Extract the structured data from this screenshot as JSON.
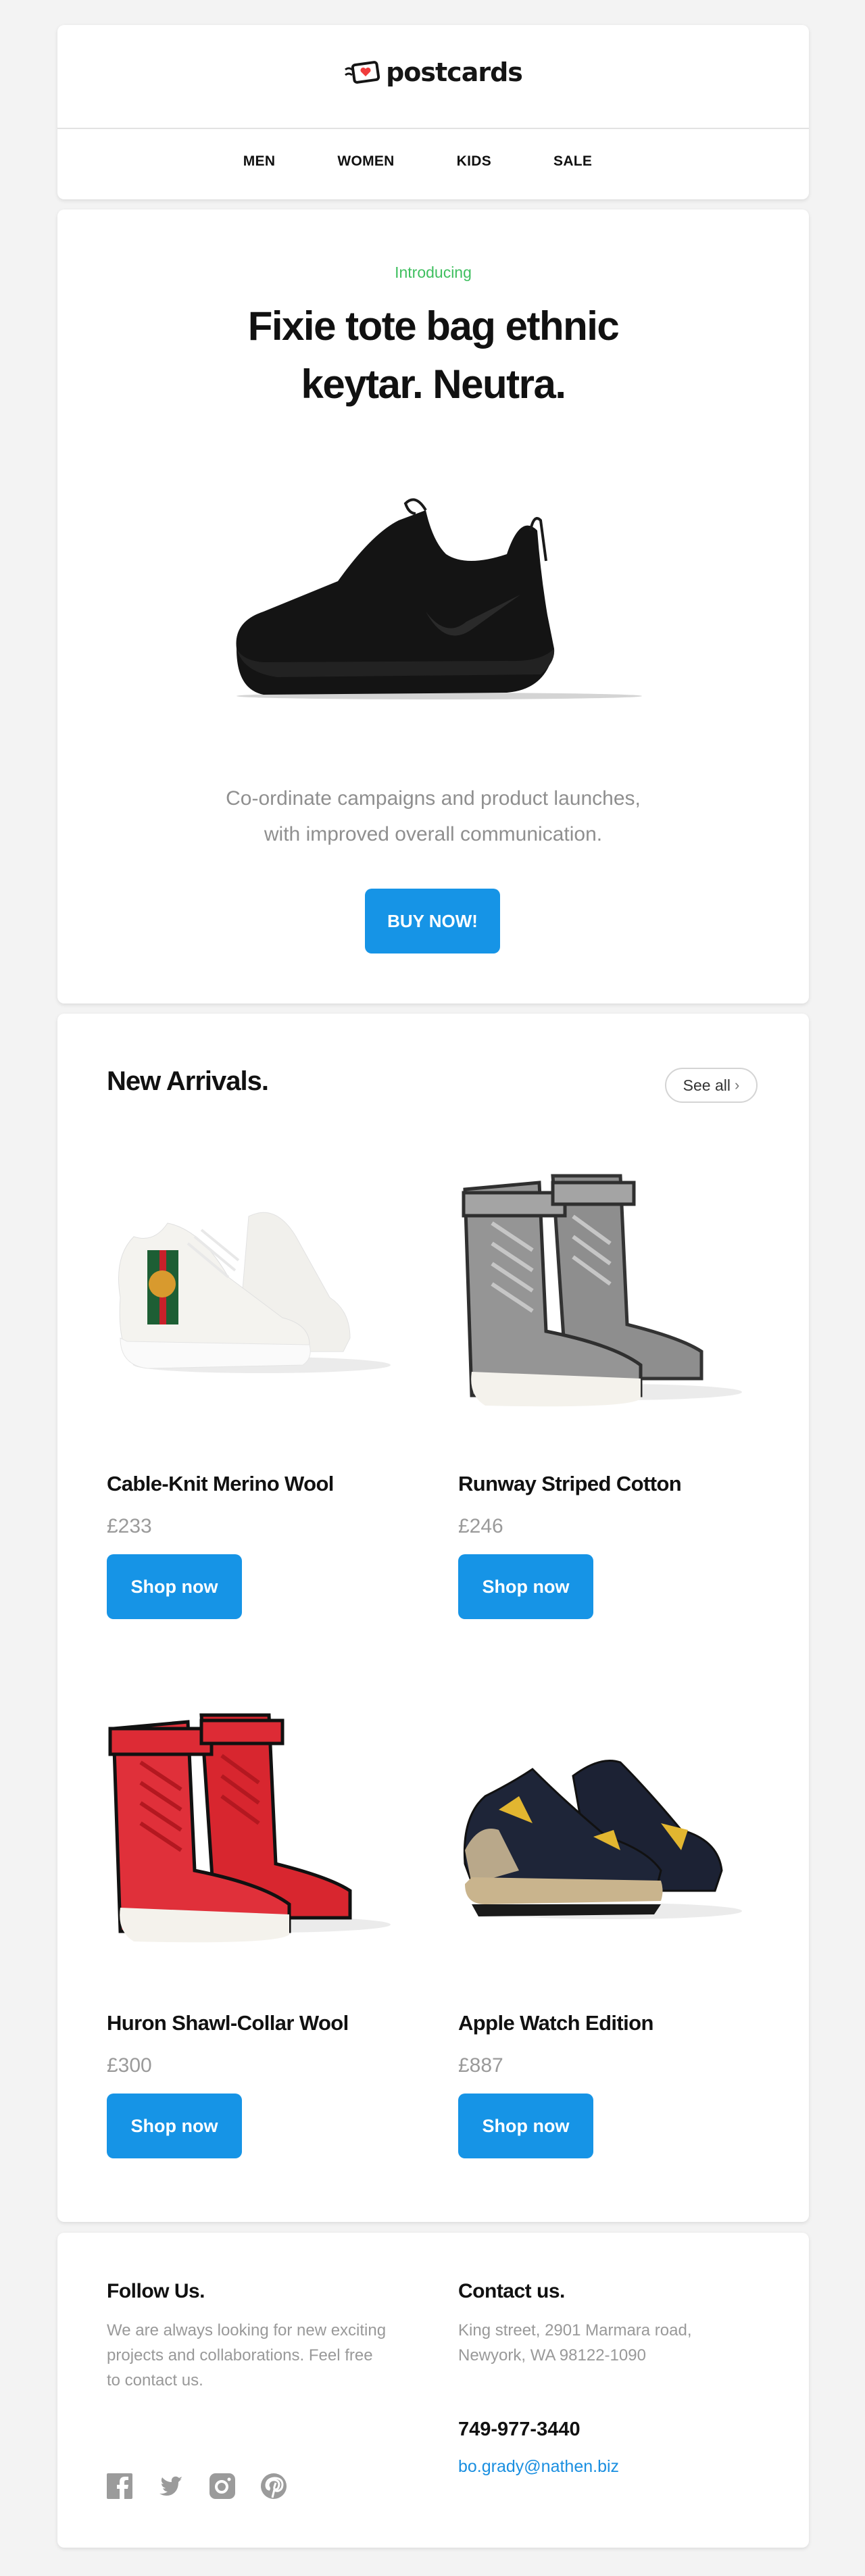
{
  "brand": {
    "name": "postcards",
    "heart_color": "#f03c3c"
  },
  "nav": {
    "items": [
      {
        "label": "MEN"
      },
      {
        "label": "WOMEN"
      },
      {
        "label": "KIDS"
      },
      {
        "label": "SALE"
      }
    ]
  },
  "hero": {
    "eyebrow": "Introducing",
    "title_line1": "Fixie tote bag ethnic",
    "title_line2": "keytar. Neutra.",
    "image": "black-sneaker",
    "desc_line1": "Co-ordinate campaigns and product launches,",
    "desc_line2": "with improved overall communication.",
    "cta": "BUY NOW!"
  },
  "arrivals": {
    "title": "New Arrivals.",
    "see_all": "See all",
    "products": [
      {
        "name": "Cable-Knit Merino Wool",
        "price": "£233",
        "cta": "Shop now",
        "image": "white-sneaker"
      },
      {
        "name": "Runway Striped Cotton",
        "price": "£246",
        "cta": "Shop now",
        "image": "grey-high-top-boot"
      },
      {
        "name": "Huron Shawl-Collar Wool",
        "price": "£300",
        "cta": "Shop now",
        "image": "red-high-top-boot"
      },
      {
        "name": "Apple Watch Edition",
        "price": "£887",
        "cta": "Shop now",
        "image": "camo-sneaker"
      }
    ]
  },
  "footer": {
    "follow_title": "Follow Us.",
    "follow_lines": [
      "We are always looking for new exciting",
      "projects and collaborations. Feel free",
      "to contact us."
    ],
    "contact_title": "Contact us.",
    "address_lines": [
      "King street, 2901 Marmara road,",
      "Newyork, WA 98122-1090"
    ],
    "phone": "749-977-3440",
    "email": "bo.grady@nathen.biz",
    "socials": [
      "facebook-icon",
      "twitter-icon",
      "instagram-icon",
      "pinterest-icon"
    ]
  },
  "colors": {
    "accent_blue": "#1694e6",
    "link_blue": "#1a8fe0",
    "eyebrow_green": "#3fbf5f",
    "muted_gray": "#999999",
    "background": "#f3f3f3"
  }
}
